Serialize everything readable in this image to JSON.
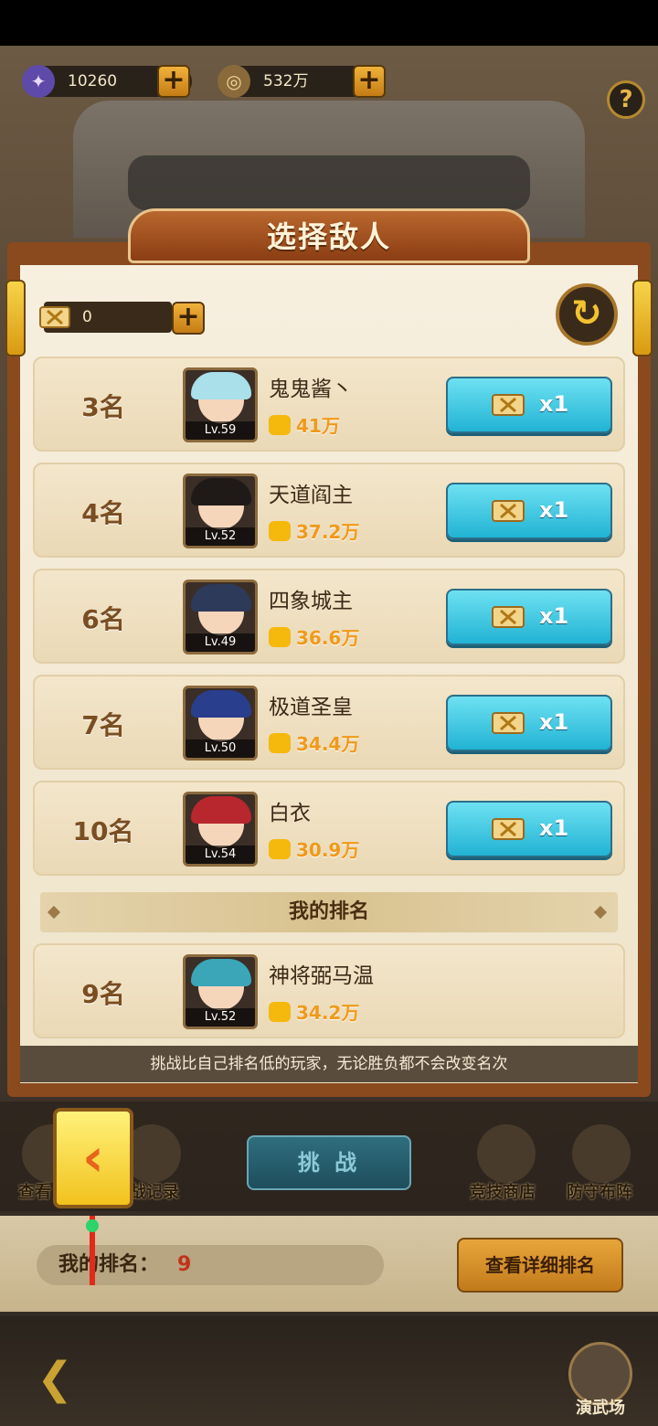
{
  "currencies": [
    {
      "icon": "purple-gem-icon",
      "value": "10260"
    },
    {
      "icon": "copper-coin-icon",
      "value": "532万"
    }
  ],
  "help_label": "?",
  "dialog": {
    "title": "选择敌人",
    "ticket_count": "0",
    "refresh_icon": "refresh-icon"
  },
  "opponents": [
    {
      "rank": "3名",
      "name": "鬼鬼酱丶",
      "level": "Lv.59",
      "power": "41万",
      "cost": "x1",
      "hair": "#a9e0ea"
    },
    {
      "rank": "4名",
      "name": "天道阎主",
      "level": "Lv.52",
      "power": "37.2万",
      "cost": "x1",
      "hair": "#1f1a18"
    },
    {
      "rank": "6名",
      "name": "四象城主",
      "level": "Lv.49",
      "power": "36.6万",
      "cost": "x1",
      "hair": "#2e3a5a"
    },
    {
      "rank": "7名",
      "name": "极道圣皇",
      "level": "Lv.50",
      "power": "34.4万",
      "cost": "x1",
      "hair": "#2a3e8e"
    },
    {
      "rank": "10名",
      "name": "白衣",
      "level": "Lv.54",
      "power": "30.9万",
      "cost": "x1",
      "hair": "#b8262e"
    }
  ],
  "my_ranking": {
    "heading": "我的排名",
    "rank": "9名",
    "name": "神将弼马温",
    "level": "Lv.52",
    "power": "34.2万",
    "hair": "#3aa6b8"
  },
  "notice": "挑战比自己排名低的玩家，无论胜负都不会改变名次",
  "bottom_nav": {
    "left_items": [
      "查看",
      "战记录"
    ],
    "challenge_label": "挑 战",
    "right_items": [
      "竞技商店",
      "防守布阵"
    ]
  },
  "rank_bar": {
    "label": "我的排名：",
    "value": "9",
    "detail_button": "查看详细排名"
  },
  "footer": {
    "arena_label": "演武场"
  },
  "colors": {
    "accent_cyan": "#21b3d4",
    "power_orange": "#f09a1a",
    "panel_brown": "#8a4a1e"
  }
}
